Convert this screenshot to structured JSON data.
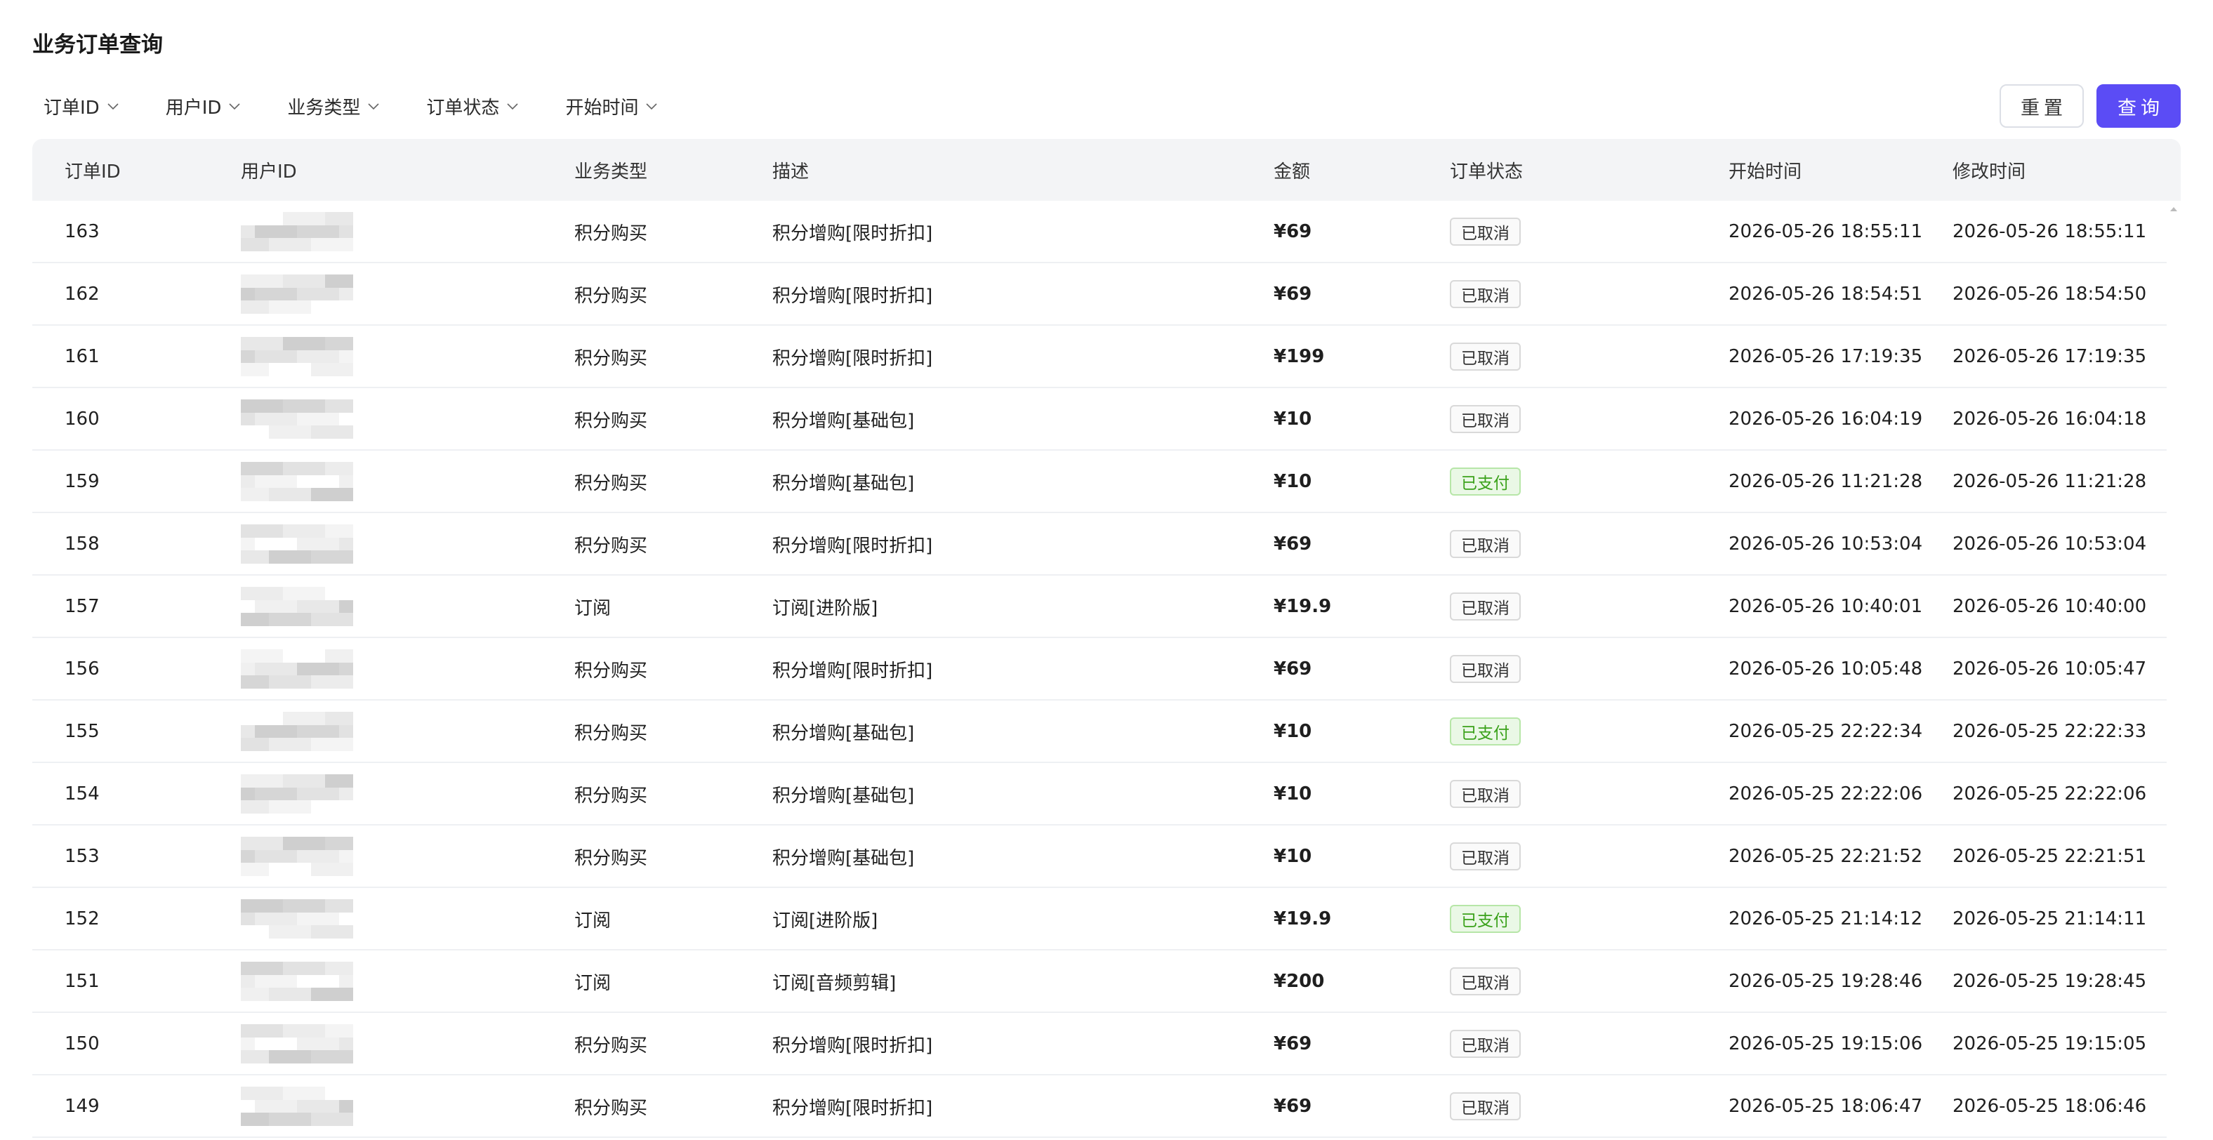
{
  "page": {
    "title": "业务订单查询"
  },
  "filters": [
    {
      "label": "订单ID",
      "icon": "chevron-down-icon"
    },
    {
      "label": "用户ID",
      "icon": "chevron-down-icon"
    },
    {
      "label": "业务类型",
      "icon": "chevron-down-icon"
    },
    {
      "label": "订单状态",
      "icon": "chevron-down-icon"
    },
    {
      "label": "开始时间",
      "icon": "chevron-down-icon"
    }
  ],
  "actions": {
    "reset_label": "重置",
    "search_label": "查询"
  },
  "colors": {
    "primary": "#5b4cf5",
    "paid_text": "#3aa11a",
    "paid_bg": "#eaf8e6",
    "header_bg": "#f3f4f6"
  },
  "table": {
    "columns": [
      "订单ID",
      "用户ID",
      "业务类型",
      "描述",
      "金额",
      "订单状态",
      "开始时间",
      "修改时间"
    ],
    "rows": [
      {
        "id": "163",
        "type": "积分购买",
        "desc": "积分增购[限时折扣]",
        "amount": "¥69",
        "status": "已取消",
        "status_kind": "cancel",
        "start": "2026-05-26 18:55:11",
        "modified": "2026-05-26 18:55:11"
      },
      {
        "id": "162",
        "type": "积分购买",
        "desc": "积分增购[限时折扣]",
        "amount": "¥69",
        "status": "已取消",
        "status_kind": "cancel",
        "start": "2026-05-26 18:54:51",
        "modified": "2026-05-26 18:54:50"
      },
      {
        "id": "161",
        "type": "积分购买",
        "desc": "积分增购[限时折扣]",
        "amount": "¥199",
        "status": "已取消",
        "status_kind": "cancel",
        "start": "2026-05-26 17:19:35",
        "modified": "2026-05-26 17:19:35"
      },
      {
        "id": "160",
        "type": "积分购买",
        "desc": "积分增购[基础包]",
        "amount": "¥10",
        "status": "已取消",
        "status_kind": "cancel",
        "start": "2026-05-26 16:04:19",
        "modified": "2026-05-26 16:04:18"
      },
      {
        "id": "159",
        "type": "积分购买",
        "desc": "积分增购[基础包]",
        "amount": "¥10",
        "status": "已支付",
        "status_kind": "paid",
        "start": "2026-05-26 11:21:28",
        "modified": "2026-05-26 11:21:28"
      },
      {
        "id": "158",
        "type": "积分购买",
        "desc": "积分增购[限时折扣]",
        "amount": "¥69",
        "status": "已取消",
        "status_kind": "cancel",
        "start": "2026-05-26 10:53:04",
        "modified": "2026-05-26 10:53:04"
      },
      {
        "id": "157",
        "type": "订阅",
        "desc": "订阅[进阶版]",
        "amount": "¥19.9",
        "status": "已取消",
        "status_kind": "cancel",
        "start": "2026-05-26 10:40:01",
        "modified": "2026-05-26 10:40:00"
      },
      {
        "id": "156",
        "type": "积分购买",
        "desc": "积分增购[限时折扣]",
        "amount": "¥69",
        "status": "已取消",
        "status_kind": "cancel",
        "start": "2026-05-26 10:05:48",
        "modified": "2026-05-26 10:05:47"
      },
      {
        "id": "155",
        "type": "积分购买",
        "desc": "积分增购[基础包]",
        "amount": "¥10",
        "status": "已支付",
        "status_kind": "paid",
        "start": "2026-05-25 22:22:34",
        "modified": "2026-05-25 22:22:33"
      },
      {
        "id": "154",
        "type": "积分购买",
        "desc": "积分增购[基础包]",
        "amount": "¥10",
        "status": "已取消",
        "status_kind": "cancel",
        "start": "2026-05-25 22:22:06",
        "modified": "2026-05-25 22:22:06"
      },
      {
        "id": "153",
        "type": "积分购买",
        "desc": "积分增购[基础包]",
        "amount": "¥10",
        "status": "已取消",
        "status_kind": "cancel",
        "start": "2026-05-25 22:21:52",
        "modified": "2026-05-25 22:21:51"
      },
      {
        "id": "152",
        "type": "订阅",
        "desc": "订阅[进阶版]",
        "amount": "¥19.9",
        "status": "已支付",
        "status_kind": "paid",
        "start": "2026-05-25 21:14:12",
        "modified": "2026-05-25 21:14:11"
      },
      {
        "id": "151",
        "type": "订阅",
        "desc": "订阅[音频剪辑]",
        "amount": "¥200",
        "status": "已取消",
        "status_kind": "cancel",
        "start": "2026-05-25 19:28:46",
        "modified": "2026-05-25 19:28:45"
      },
      {
        "id": "150",
        "type": "积分购买",
        "desc": "积分增购[限时折扣]",
        "amount": "¥69",
        "status": "已取消",
        "status_kind": "cancel",
        "start": "2026-05-25 19:15:06",
        "modified": "2026-05-25 19:15:05"
      },
      {
        "id": "149",
        "type": "积分购买",
        "desc": "积分增购[限时折扣]",
        "amount": "¥69",
        "status": "已取消",
        "status_kind": "cancel",
        "start": "2026-05-25 18:06:47",
        "modified": "2026-05-25 18:06:46"
      }
    ]
  }
}
